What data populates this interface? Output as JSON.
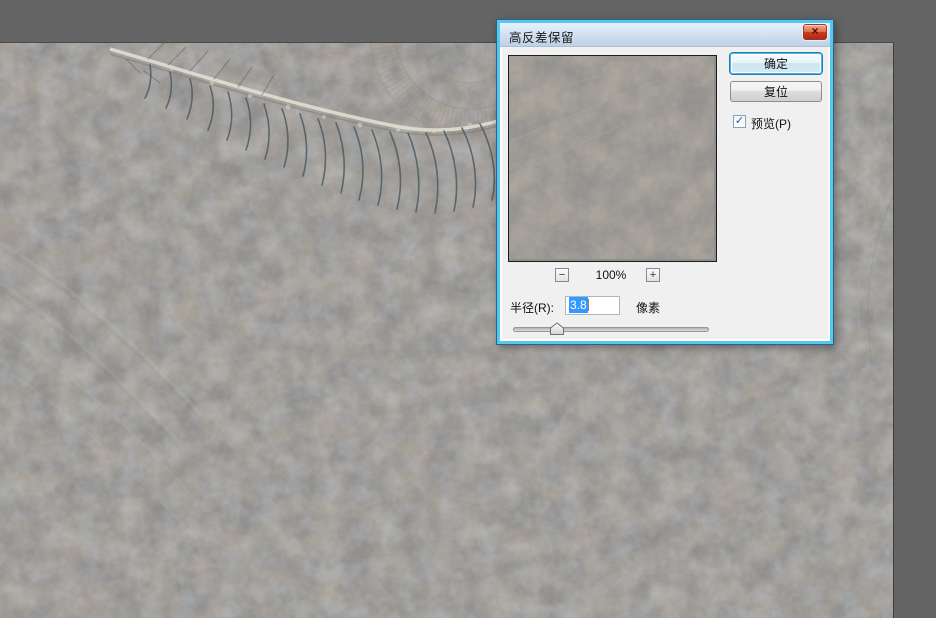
{
  "app": {
    "background_color": "#646464",
    "canvas_color": "#8b8987"
  },
  "dialog": {
    "title": "高反差保留",
    "ok_label": "确定",
    "reset_label": "复位",
    "preview_label": "预览(P)",
    "preview_checked": true,
    "zoom_level": "100%",
    "radius_label": "半径(R):",
    "radius_value": "3.8",
    "radius_unit": "像素",
    "icons": {
      "close": "×",
      "zoom_out": "−",
      "zoom_in": "+",
      "check": "✓"
    },
    "colors": {
      "accent_border": "#56c7f1",
      "selection_highlight": "#3399fe",
      "close_button": "#ce3a21",
      "titlebar": "#cfdff0",
      "dialog_face": "#f0f0f0"
    }
  }
}
